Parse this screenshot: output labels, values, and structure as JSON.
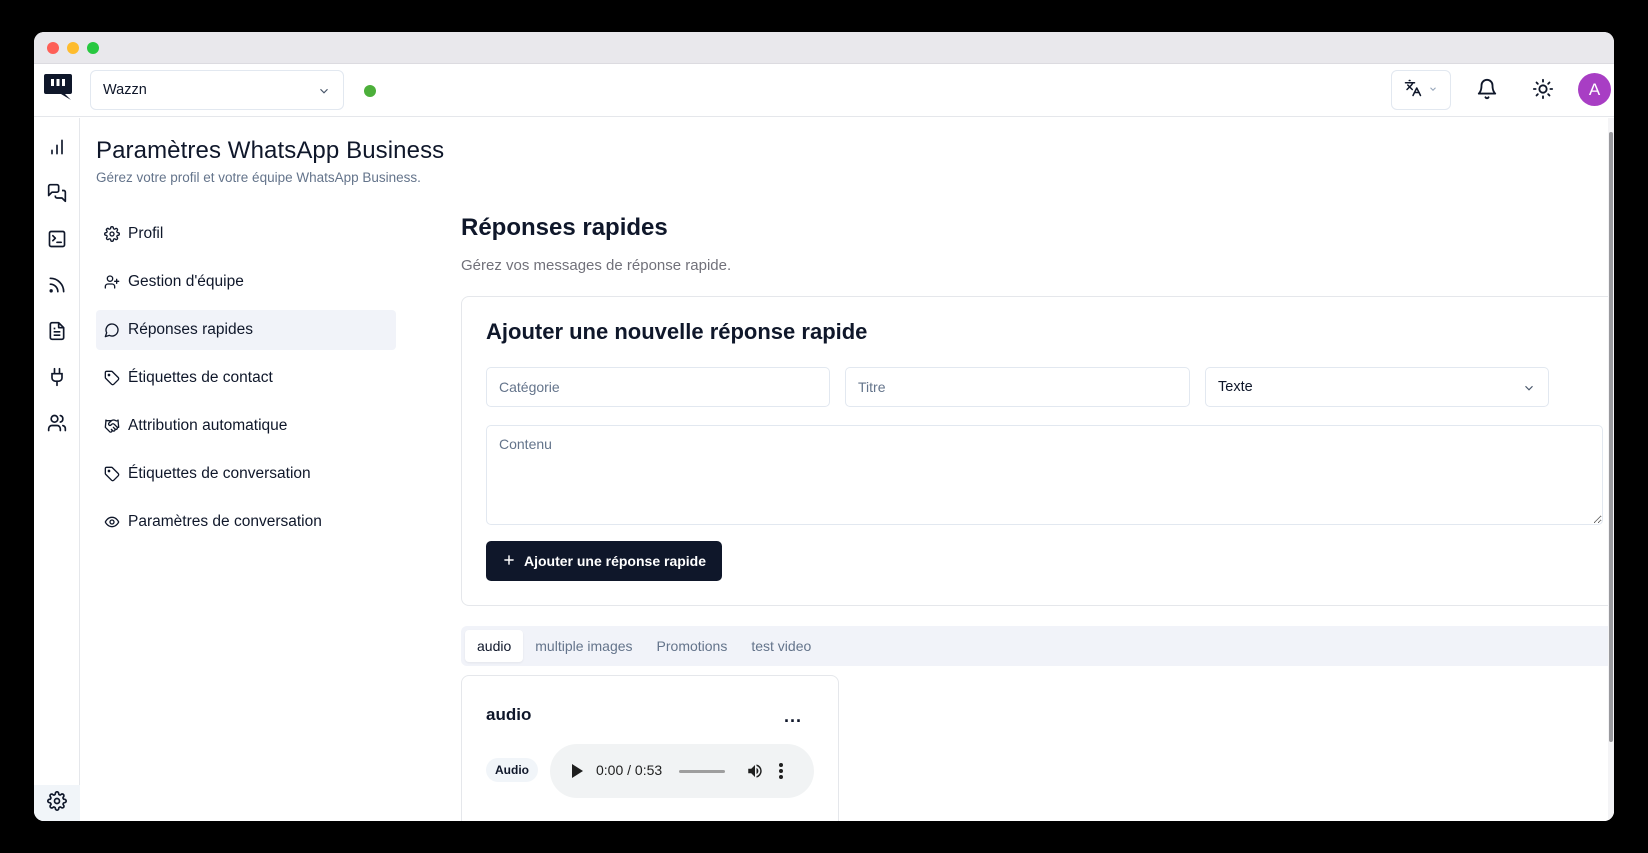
{
  "topbar": {
    "workspace": "Wazzn",
    "avatar_initial": "A",
    "status_color": "#4caf3a"
  },
  "rail": {
    "icons": [
      "bar-chart-icon",
      "messages-icon",
      "terminal-icon",
      "rss-icon",
      "document-icon",
      "plug-icon",
      "users-icon",
      "settings-icon"
    ]
  },
  "page": {
    "title": "Paramètres WhatsApp Business",
    "subtitle": "Gérez votre profil et votre équipe WhatsApp Business."
  },
  "nav": {
    "items": [
      {
        "label": "Profil",
        "icon": "gear-icon"
      },
      {
        "label": "Gestion d'équipe",
        "icon": "user-plus-icon"
      },
      {
        "label": "Réponses rapides",
        "icon": "message-circle-icon",
        "active": true
      },
      {
        "label": "Étiquettes de contact",
        "icon": "tag-icon"
      },
      {
        "label": "Attribution automatique",
        "icon": "handshake-icon"
      },
      {
        "label": "Étiquettes de conversation",
        "icon": "tag-icon"
      },
      {
        "label": "Paramètres de conversation",
        "icon": "eye-icon"
      }
    ]
  },
  "section": {
    "title": "Réponses rapides",
    "subtitle": "Gérez vos messages de réponse rapide."
  },
  "form": {
    "title": "Ajouter une nouvelle réponse rapide",
    "category_placeholder": "Catégorie",
    "title_placeholder": "Titre",
    "type_value": "Texte",
    "content_placeholder": "Contenu",
    "submit_label": "Ajouter une réponse rapide"
  },
  "tabs": [
    {
      "label": "audio",
      "active": true
    },
    {
      "label": "multiple images"
    },
    {
      "label": "Promotions"
    },
    {
      "label": "test video"
    }
  ],
  "item": {
    "title": "audio",
    "menu": "...",
    "badge": "Audio",
    "time": "0:00 / 0:53"
  },
  "colors": {
    "accent_dark": "#0f172a",
    "avatar": "#a83ec4",
    "status_online": "#4caf3a"
  }
}
